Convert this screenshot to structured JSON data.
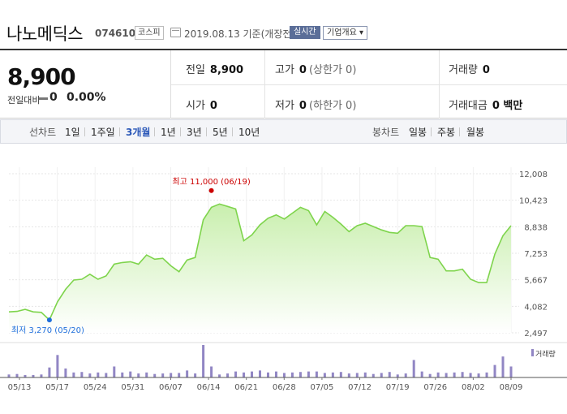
{
  "header": {
    "company_name": "나노메딕스",
    "code": "074610",
    "market": "코스피",
    "date_text": "2019.08.13  기준(개장전)",
    "realtime_btn": "실시간",
    "company_info_btn": "기업개요 ▾"
  },
  "quote": {
    "price": "8,900",
    "change_label": "전일대비",
    "change_value": "0",
    "change_pct": "0.00%",
    "prev_close": {
      "label": "전일",
      "value": "8,900"
    },
    "high": {
      "label": "고가",
      "value": "0",
      "sub": "(상한가 0)"
    },
    "volume": {
      "label": "거래량",
      "value": "0"
    },
    "open": {
      "label": "시가",
      "value": "0"
    },
    "low": {
      "label": "저가",
      "value": "0",
      "sub": "(하한가 0)"
    },
    "trade_value": {
      "label": "거래대금",
      "value": "0 백만"
    }
  },
  "tabs": {
    "line_label": "선차트",
    "line_periods": [
      "1일",
      "1주일",
      "3개월",
      "1년",
      "3년",
      "5년",
      "10년"
    ],
    "selected_period": "3개월",
    "candle_label": "봉차트",
    "candle_periods": [
      "일봉",
      "주봉",
      "월봉"
    ]
  },
  "colors": {
    "line": "#7ed44c",
    "fill_top": "#c9efae",
    "fill_bottom": "#ffffff",
    "volume_bar": "#9186c4",
    "high_marker": "#cc0000",
    "low_marker": "#1f6fdb",
    "selected_tab": "#2b58b8"
  },
  "chart_data": {
    "type": "area",
    "y_ticks": [
      "12,008",
      "10,423",
      "8,838",
      "7,253",
      "5,667",
      "4,082",
      "2,497"
    ],
    "ylim": [
      2497,
      12008
    ],
    "x_labels": [
      "05/13",
      "05/17",
      "05/24",
      "05/31",
      "06/07",
      "06/14",
      "06/21",
      "06/28",
      "07/05",
      "07/12",
      "07/19",
      "07/26",
      "08/02",
      "08/09"
    ],
    "series": [
      {
        "values": [
          3750,
          3780,
          3900,
          3750,
          3720,
          3270,
          4350,
          5100,
          5650,
          5700,
          6000,
          5700,
          5900,
          6600,
          6700,
          6750,
          6600,
          7150,
          6900,
          6950,
          6500,
          6150,
          6850,
          7000,
          9250,
          10000,
          10200,
          10050,
          9900,
          8000,
          8350,
          8950,
          9350,
          9550,
          9300,
          9650,
          10000,
          9800,
          8950,
          9750,
          9400,
          9000,
          8550,
          8900,
          9050,
          8850,
          8650,
          8500,
          8450,
          8900,
          8900,
          8850,
          7000,
          6900,
          6200,
          6200,
          6300,
          5700,
          5500,
          5500,
          7200,
          8300,
          8900
        ]
      }
    ],
    "volume_label": "거래량",
    "volume": [
      6,
      7,
      5,
      5,
      6,
      20,
      45,
      18,
      10,
      11,
      8,
      10,
      9,
      22,
      10,
      12,
      8,
      10,
      7,
      8,
      9,
      9,
      14,
      8,
      65,
      22,
      6,
      8,
      12,
      10,
      12,
      14,
      10,
      12,
      9,
      10,
      11,
      12,
      12,
      9,
      10,
      11,
      8,
      9,
      10,
      7,
      9,
      11,
      6,
      8,
      35,
      12,
      7,
      10,
      9,
      10,
      11,
      9,
      8,
      10,
      25,
      42,
      22
    ],
    "high_annotation": {
      "text": "최고 11,000 (06/19)",
      "value": 11000
    },
    "low_annotation": {
      "text": "최저 3,270 (05/20)",
      "value": 3270
    }
  }
}
